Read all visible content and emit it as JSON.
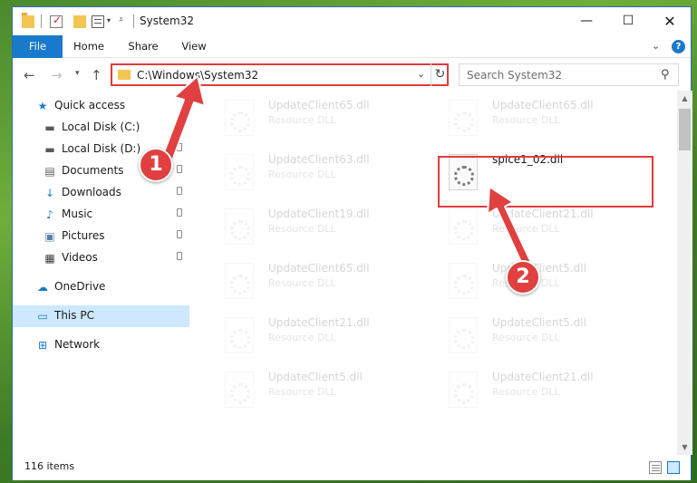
{
  "window": {
    "title": "System32",
    "controls": {
      "minimize": "—",
      "maximize": "☐",
      "close": "✕"
    }
  },
  "ribbon": {
    "tabs": [
      "File",
      "Home",
      "Share",
      "View"
    ],
    "expand_icon": "chevron-down-icon",
    "help": "?"
  },
  "nav": {
    "back": "←",
    "forward": "→",
    "history": "▾",
    "up": "↑",
    "address": "C:\\Windows\\System32",
    "address_dropdown": "⌄",
    "refresh": "↻",
    "search_placeholder": "Search System32",
    "search_icon": "⚲"
  },
  "sidebar": {
    "items": [
      {
        "label": "Quick access",
        "icon": "star-icon",
        "glyph": "★",
        "color": "#1979ca",
        "pinned": false
      },
      {
        "label": "Local Disk (C:)",
        "icon": "drive-icon",
        "glyph": "▬",
        "color": "#5a5a5a",
        "pinned": true
      },
      {
        "label": "Local Disk (D:)",
        "icon": "drive-icon",
        "glyph": "▬",
        "color": "#5a5a5a",
        "pinned": true
      },
      {
        "label": "Documents",
        "icon": "document-icon",
        "glyph": "▤",
        "color": "#5a5a5a",
        "pinned": true
      },
      {
        "label": "Downloads",
        "icon": "download-icon",
        "glyph": "↓",
        "color": "#1979ca",
        "pinned": true
      },
      {
        "label": "Music",
        "icon": "music-icon",
        "glyph": "♪",
        "color": "#1979ca",
        "pinned": true
      },
      {
        "label": "Pictures",
        "icon": "pictures-icon",
        "glyph": "▣",
        "color": "#5a7ea8",
        "pinned": true
      },
      {
        "label": "Videos",
        "icon": "video-icon",
        "glyph": "▦",
        "color": "#3a3a3a",
        "pinned": true
      },
      {
        "label": "OneDrive",
        "icon": "cloud-icon",
        "glyph": "☁",
        "color": "#1979ca",
        "pinned": false
      },
      {
        "label": "This PC",
        "icon": "computer-icon",
        "glyph": "▭",
        "color": "#1979ca",
        "pinned": false,
        "selected": true
      },
      {
        "label": "Network",
        "icon": "network-icon",
        "glyph": "⊞",
        "color": "#1979ca",
        "pinned": false
      }
    ]
  },
  "files": {
    "left": [
      {
        "name": "UpdateClient65.dll",
        "type": "Resource DLL"
      },
      {
        "name": "UpdateClient63.dll",
        "type": "Resource DLL"
      },
      {
        "name": "UpdateClient19.dll",
        "type": "Resource DLL"
      },
      {
        "name": "UpdateClient65.dll",
        "type": "Resource DLL"
      },
      {
        "name": "UpdateClient21.dll",
        "type": "Resource DLL"
      },
      {
        "name": "UpdateClient5.dll",
        "type": "Resource DLL"
      }
    ],
    "right": [
      {
        "name": "UpdateClient65.dll",
        "type": "Resource DLL"
      },
      {
        "name": "spice1_02.dll",
        "type": "",
        "highlighted": true
      },
      {
        "name": "UpdateClient21.dll",
        "type": "Resource DLL"
      },
      {
        "name": "UpdateClient5.dll",
        "type": "Resource DLL"
      },
      {
        "name": "UpdateClient5.dll",
        "type": "Resource DLL"
      },
      {
        "name": "UpdateClient21.dll",
        "type": "Resource DLL"
      }
    ]
  },
  "status": {
    "item_count": "116 items"
  },
  "annotations": {
    "step1": "1",
    "step2": "2",
    "color": "#e04040"
  }
}
